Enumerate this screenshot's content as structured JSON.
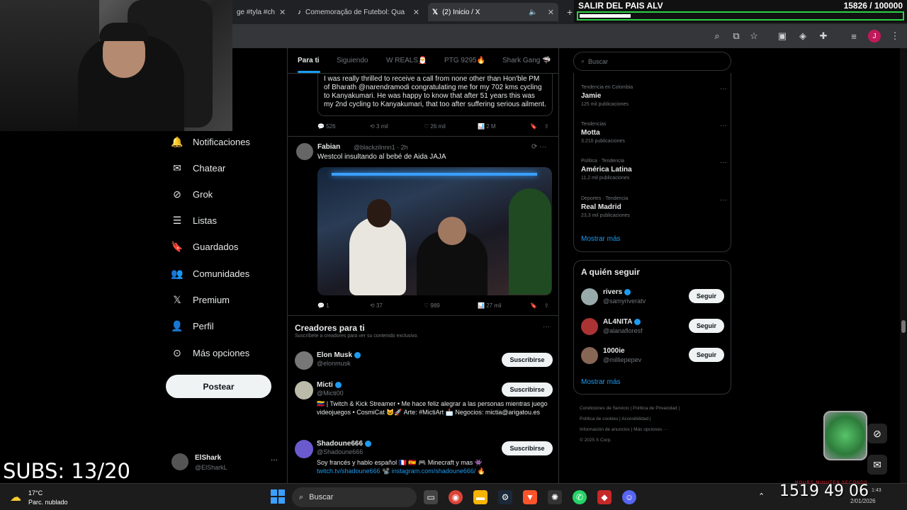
{
  "browser": {
    "tabs": [
      {
        "label": "ge #tyla #ch"
      },
      {
        "label": "Comemoração de Futebol: Qua"
      },
      {
        "label": "(2) Inicio / X"
      }
    ],
    "close_glyph": "✕",
    "new_tab_glyph": "+"
  },
  "goal_overlay": {
    "title": "SALIR DEL PAIS ALV",
    "count": "15826  / 100000",
    "progress": 0.158
  },
  "nav": {
    "items": [
      {
        "label": "Notificaciones",
        "icon": "bell-icon"
      },
      {
        "label": "Chatear",
        "icon": "mail-icon"
      },
      {
        "label": "Grok",
        "icon": "grok-icon"
      },
      {
        "label": "Listas",
        "icon": "list-icon"
      },
      {
        "label": "Guardados",
        "icon": "bookmark-icon"
      },
      {
        "label": "Comunidades",
        "icon": "people-icon"
      },
      {
        "label": "Premium",
        "icon": "x-logo-icon"
      },
      {
        "label": "Perfil",
        "icon": "person-icon"
      },
      {
        "label": "Más opciones",
        "icon": "more-circle-icon"
      }
    ],
    "post_label": "Postear",
    "account": {
      "name": "ElShark",
      "handle": "@ElSharkL",
      "more": "···"
    }
  },
  "overlay_subs": "SUBS: 13/20",
  "feed": {
    "tabs": [
      "Para ti",
      "Siguiendo",
      "W REALS🎅",
      "PTG 9295🔥",
      "Shark Gang 🦈"
    ],
    "quote_text": "I was really thrilled to receive a call from none other than Hon'ble PM of Bharath @narendramodi congratulating me for my 702 kms cycling to Kanyakumari.  He was happy to know that after 51 years this was my 2nd cycling to Kanyakumari, that too after suffering  serious ailment.",
    "tweet1_stats": {
      "replies": "526",
      "reposts": "3 mil",
      "likes": "26 mil",
      "views": "2 M"
    },
    "tweet2": {
      "name": "Fabian",
      "handle": "@blackzilnnn1 · 2h",
      "text": "Westcol insultando al bebé de Aida JAJA",
      "stats": {
        "replies": "1",
        "reposts": "37",
        "likes": "989",
        "views": "27 mil"
      }
    },
    "creators": {
      "title": "Creadores para ti",
      "subtitle": "Suscríbete a creadores para ver su contenido exclusivo.",
      "more": "···",
      "button_label": "Suscribirse",
      "items": [
        {
          "name": "Elon Musk",
          "handle": "@elonmusk",
          "bio": ""
        },
        {
          "name": "Micti",
          "handle": "@Micti00",
          "bio": "🇻🇪 | Twitch & Kick Streamer • Me hace feliz alegrar a las personas mientras juego videojuegos • CosmiCat 😺🚀 Arte: #MictiArt 📩 Negocios: mictia@arigatou.es"
        },
        {
          "name": "Shadoune666",
          "handle": "@Shadoune666",
          "bio": "Soy francés y hablo español 🇫🇷 🇪🇸 🎮 Minecraft y mas 👾",
          "links": "twitch.tv/shadoune666 📽️ instagram.com/shadoune666/ 🔥"
        }
      ]
    }
  },
  "right": {
    "search_placeholder": "Buscar",
    "trends": [
      {
        "context": "Tendencia en Colombia",
        "name": "Jamie",
        "count": "125 mil publicaciones"
      },
      {
        "context": "Tendencias",
        "name": "Motta",
        "count": "3.210 publicaciones"
      },
      {
        "context": "Política · Tendencia",
        "name": "América Latina",
        "count": "11,2 mil publicaciones"
      },
      {
        "context": "Deportes · Tendencia",
        "name": "Real Madrid",
        "count": "23,3 mil publicaciones"
      }
    ],
    "trends_more": "Mostrar más",
    "follow": {
      "title": "A quién seguir",
      "button_label": "Seguir",
      "items": [
        {
          "name": "rivers",
          "handle": "@samyriveratv"
        },
        {
          "name": "AL4NITA",
          "handle": "@alanafloresf"
        },
        {
          "name": "1000ie",
          "handle": "@milliepepev"
        }
      ],
      "more": "Mostrar más"
    },
    "footer": {
      "line1": "Condiciones de Servicio  |  Política de Privacidad  |",
      "line2": "Política de cookies  |  Accesibilidad  |",
      "line3": "Información de anuncios  |  Más opciones ···",
      "line4": "© 2025 X Corp."
    }
  },
  "taskbar": {
    "weather_temp": "17°C",
    "weather_desc": "Parc. nublado",
    "search_label": "Buscar",
    "clock_big": "1519  49  06",
    "clock_small": "1:43",
    "clock_date": "2/01/2026",
    "timer_labels": "HOURS    MINUTES    SECONDS"
  },
  "colors": {
    "accent": "#1d9bf0",
    "goal_green": "#2bd147"
  }
}
